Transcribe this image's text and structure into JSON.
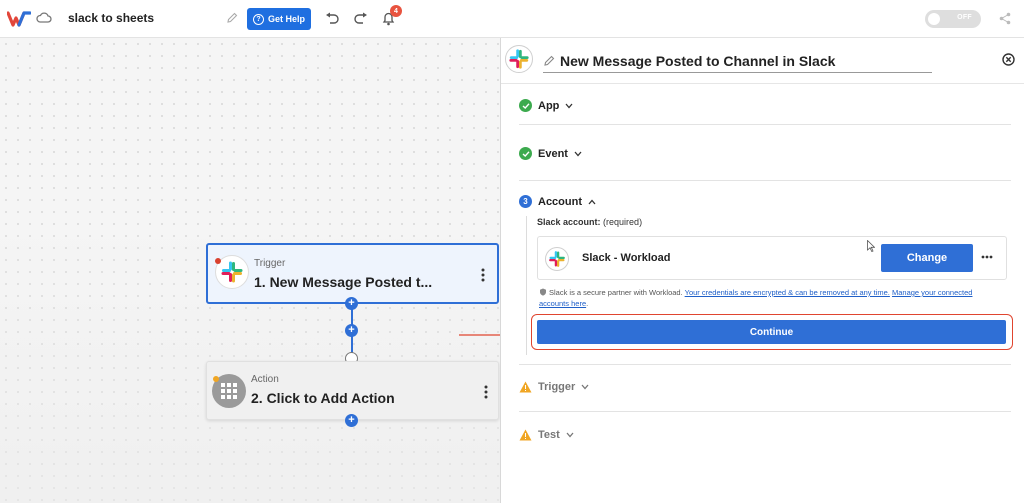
{
  "header": {
    "workflow_name": "slack to sheets",
    "get_help_label": "Get Help",
    "notification_count": "4",
    "toggle_label": "OFF"
  },
  "canvas": {
    "trigger": {
      "kind": "Trigger",
      "title": "1. New Message Posted t..."
    },
    "action": {
      "kind": "Action",
      "title": "2. Click to Add Action"
    }
  },
  "panel": {
    "title": "New Message Posted to Channel in Slack",
    "sections": {
      "app": "App",
      "event": "Event",
      "account": "Account",
      "account_step": "3",
      "trigger": "Trigger",
      "test": "Test"
    },
    "account": {
      "label": "Slack account:",
      "required": "(required)",
      "name": "Slack - Workload",
      "change_label": "Change",
      "note_prefix": "Slack is a secure partner with Workload.",
      "note_link1": "Your credentials are encrypted & can be removed at any time.",
      "note_link2": "Manage your connected accounts here",
      "note_suffix": ".",
      "continue_label": "Continue"
    }
  },
  "colors": {
    "primary": "#2f6fd6",
    "success": "#3caa4e",
    "warning": "#f0a624",
    "highlight": "#e0452f",
    "badge": "#e8533f"
  }
}
